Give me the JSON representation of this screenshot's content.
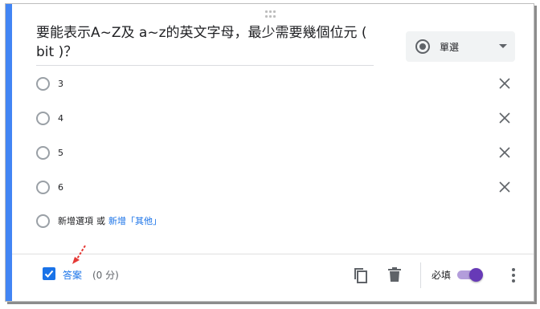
{
  "question": {
    "title": "要能表示A~Z及 a~z的英文字母，最少需要幾個位元 ( bit )？"
  },
  "question_type": {
    "label": "單選",
    "icon": "radio-button-icon"
  },
  "options": [
    {
      "label": "3"
    },
    {
      "label": "4"
    },
    {
      "label": "5"
    },
    {
      "label": "6"
    }
  ],
  "add_option": {
    "add_label": "新增選項",
    "or_label": "或",
    "add_other_label": "新增「其他」"
  },
  "footer": {
    "answer_label": "答案",
    "points_label": "(0 分)",
    "required_label": "必填",
    "required_on": true
  },
  "colors": {
    "accent": "#4285f4",
    "link": "#1a73e8",
    "toggle": "#673ab7",
    "annotation_arrow": "#e53935"
  }
}
